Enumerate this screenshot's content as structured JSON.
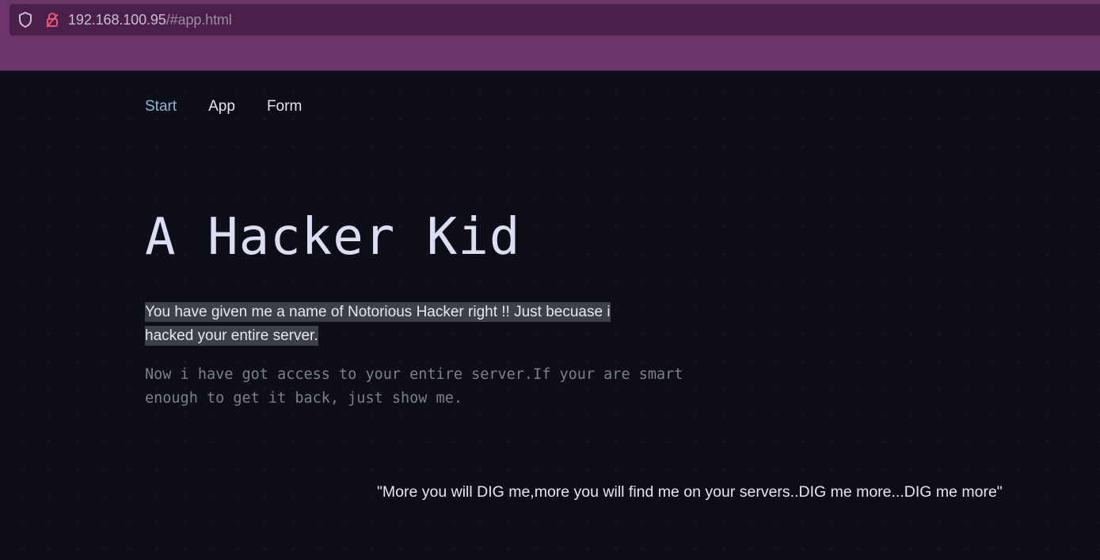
{
  "browser": {
    "url_host": "192.168.100.95",
    "url_path": "/#app.html",
    "icons": [
      "shield-icon",
      "lock-icon"
    ],
    "chrome_color": "#6b3569",
    "urlbar_color": "#4a1f4a"
  },
  "nav": {
    "items": [
      {
        "label": "Start",
        "active": true
      },
      {
        "label": "App",
        "active": false
      },
      {
        "label": "Form",
        "active": false
      }
    ]
  },
  "hero": {
    "title": "A Hacker Kid",
    "intro": "You have given me a name of Notorious Hacker right !! Just becuase i hacked your entire server.",
    "message": "Now i have got access to your entire server.If your are smart enough to get it back, just show me.",
    "quote": "\"More you will DIG me,more you will find me on your servers..DIG me more...DIG me more\""
  },
  "colors": {
    "background": "#0d0e18",
    "nav_active": "#8cb9d8",
    "title": "#dcdcf3",
    "highlight": "#3d3f4a"
  }
}
